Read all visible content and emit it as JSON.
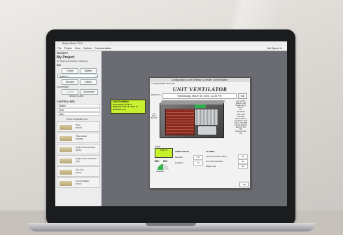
{
  "app": {
    "title": "Andor Room V7.5",
    "menu": [
      "File",
      "Project",
      "View",
      "Options",
      "Documentation"
    ],
    "sign_in": "Not Signed In"
  },
  "sidebar": {
    "project_header": "PROJECT",
    "project_name": "My Project",
    "project_sub": "No Tenant  Administrator  / Advanced",
    "site_header": "Site",
    "global_button": "Global",
    "system_button": "System",
    "system_select": "System 1",
    "rename_button": "Rename",
    "delete_button": "Delete",
    "connection_header": "Connection",
    "connect_button": "Connect",
    "disconnect_button": "Disconnect",
    "serial_label": "Serial:  COM4",
    "controllers_header": "CONTROLLERS",
    "list": [
      "Master",
      "Zone",
      "Other"
    ],
    "device_header": "Zone Controller List",
    "devices": [
      "Zone\n(HGR)",
      "Thermostat\n(TR2M)",
      "Single Zone Rooftop\n(RTU)",
      "Single Zone Ventilator\n(UV)",
      "Fan Coil\n(FCU)",
      "Unit Ventilator\n(UVC)"
    ]
  },
  "callout": {
    "title": "Unit Ventilator",
    "lines": [
      "Zone Temp: 73.6 °F",
      "Setpoint: 72.5 °F / 73.0 °F",
      "Demand: 0 %",
      "Supply Temp: 55 °F"
    ]
  },
  "dialog": {
    "title": "Configuration of Unit Ventilator Controller \"Unit Ventilator\"",
    "menu": "Config   Defaults   Schedule",
    "left_label": "Date/Time",
    "heading": "UNIT VENTILATOR",
    "datetime": "Wednesday, March 19, 2025, 12:26 PM",
    "edit_button": "Edit",
    "left_values": [
      "OA",
      "Temp",
      "54.6 °F"
    ],
    "right_values": [
      "Fan: AUTO",
      "Status: LOW",
      "Supply Temp",
      "55.0 °F",
      "OA",
      "Fan Mode",
      "Cool: OFF",
      "Two Pipe",
      "Temp: 50.0 °F",
      "Coil Mode: Cool",
      "Valve: CLOSED",
      "Face & Bypass",
      "Damper Pos",
      "0%",
      "Fresh Air Pos",
      "0%"
    ],
    "zone_label": "ZONE",
    "zone_value": "73.6 °F",
    "dial_values": [
      "85%",
      "50%"
    ],
    "dial_caption": "Setpoints",
    "zone_status_header": "ZONE STATUS",
    "alarms_header": "ALARMS",
    "status_rows": [
      {
        "label": "Demand",
        "value": "0 %"
      },
      {
        "label": "Occupied",
        "value": "Yes"
      }
    ],
    "alarm_rows": [
      {
        "label": "Freeze Protection Mode",
        "value": "NO"
      },
      {
        "label": "Low OAT Protection",
        "value": "NO"
      },
      {
        "label": "Water Leak",
        "value": "NO"
      }
    ],
    "ok_button": "OK"
  }
}
